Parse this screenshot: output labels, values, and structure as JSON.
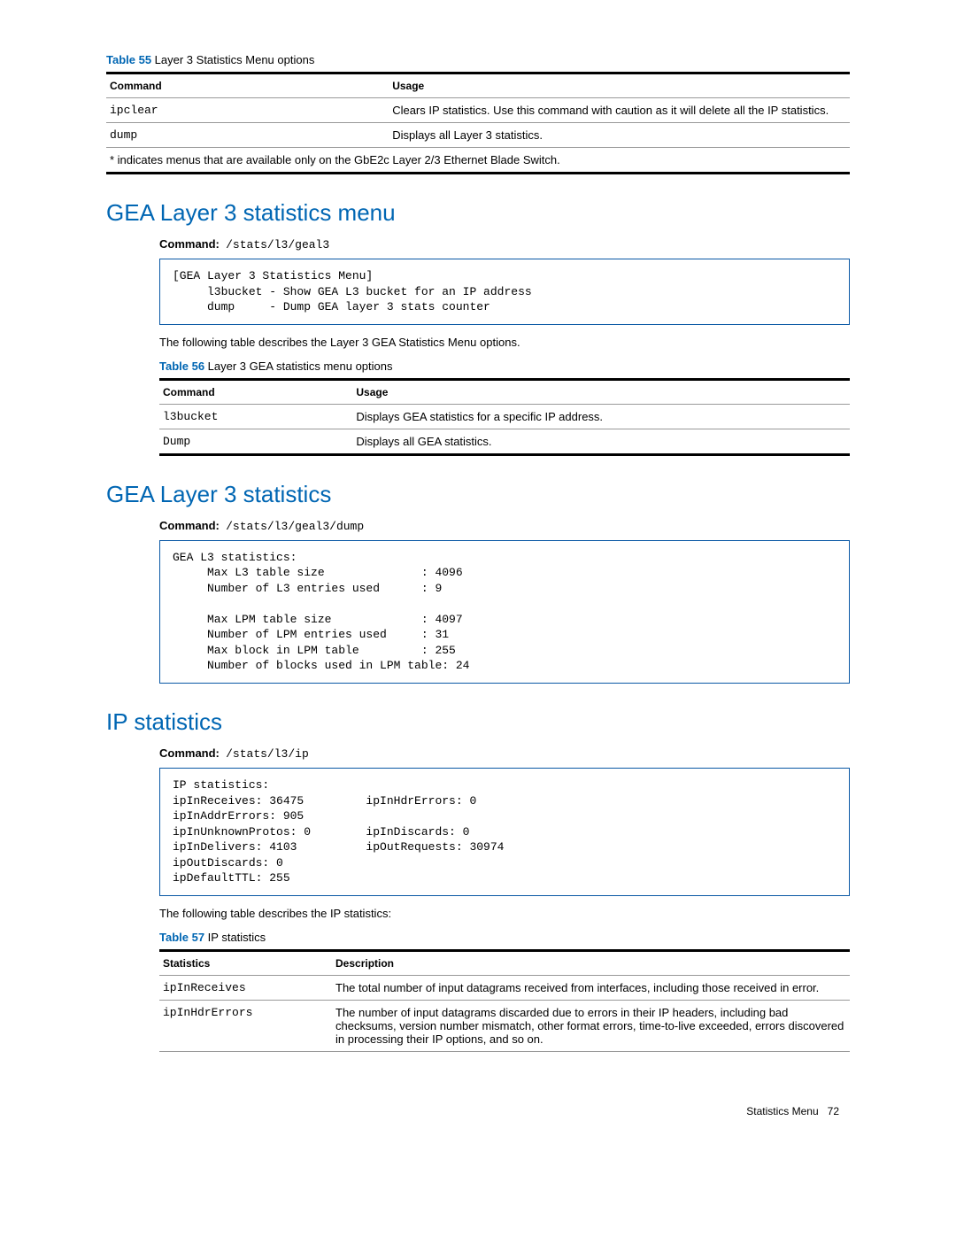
{
  "table55": {
    "caption_label": "Table 55",
    "caption_text": " Layer 3 Statistics Menu options",
    "headers": [
      "Command",
      "Usage"
    ],
    "rows": [
      {
        "cmd": "ipclear",
        "usage": "Clears IP statistics. Use this command with caution as it will delete all the IP statistics."
      },
      {
        "cmd": "dump",
        "usage": "Displays all Layer 3 statistics."
      }
    ],
    "footnote": "* indicates menus that are available only on the GbE2c Layer 2/3 Ethernet Blade Switch."
  },
  "section1": {
    "heading": "GEA Layer 3 statistics menu",
    "command_label": "Command:",
    "command_value": "/stats/l3/geal3",
    "codeblock": "[GEA Layer 3 Statistics Menu]\n     l3bucket - Show GEA L3 bucket for an IP address\n     dump     - Dump GEA layer 3 stats counter",
    "desc": "The following table describes the Layer 3 GEA Statistics Menu options."
  },
  "table56": {
    "caption_label": "Table 56",
    "caption_text": " Layer 3 GEA statistics menu options",
    "headers": [
      "Command",
      "Usage"
    ],
    "rows": [
      {
        "cmd": "l3bucket",
        "usage": "Displays GEA statistics for a specific IP address."
      },
      {
        "cmd": "Dump",
        "usage": "Displays all GEA statistics."
      }
    ]
  },
  "section2": {
    "heading": "GEA Layer 3 statistics",
    "command_label": "Command:",
    "command_value": "/stats/l3/geal3/dump",
    "codeblock": "GEA L3 statistics:\n     Max L3 table size              : 4096\n     Number of L3 entries used      : 9\n\n     Max LPM table size             : 4097\n     Number of LPM entries used     : 31\n     Max block in LPM table         : 255\n     Number of blocks used in LPM table: 24"
  },
  "section3": {
    "heading": "IP statistics",
    "command_label": "Command:",
    "command_value": "/stats/l3/ip",
    "codeblock": "IP statistics:\nipInReceives: 36475         ipInHdrErrors: 0\nipInAddrErrors: 905\nipInUnknownProtos: 0        ipInDiscards: 0\nipInDelivers: 4103          ipOutRequests: 30974\nipOutDiscards: 0\nipDefaultTTL: 255",
    "desc": "The following table describes the IP statistics:"
  },
  "table57": {
    "caption_label": "Table 57",
    "caption_text": " IP statistics",
    "headers": [
      "Statistics",
      "Description"
    ],
    "rows": [
      {
        "cmd": "ipInReceives",
        "usage": "The total number of input datagrams received from interfaces, including those received in error."
      },
      {
        "cmd": "ipInHdrErrors",
        "usage": "The number of input datagrams discarded due to errors in their IP headers, including bad checksums, version number mismatch, other format errors, time-to-live exceeded, errors discovered in processing their IP options, and so on."
      }
    ]
  },
  "chart_data": {
    "type": "table",
    "gea_l3_statistics": {
      "Max L3 table size": 4096,
      "Number of L3 entries used": 9,
      "Max LPM table size": 4097,
      "Number of LPM entries used": 31,
      "Max block in LPM table": 255,
      "Number of blocks used in LPM table": 24
    },
    "ip_statistics": {
      "ipInReceives": 36475,
      "ipInHdrErrors": 0,
      "ipInAddrErrors": 905,
      "ipInUnknownProtos": 0,
      "ipInDiscards": 0,
      "ipInDelivers": 4103,
      "ipOutRequests": 30974,
      "ipOutDiscards": 0,
      "ipDefaultTTL": 255
    }
  },
  "footer": {
    "section": "Statistics Menu",
    "page": "72"
  }
}
